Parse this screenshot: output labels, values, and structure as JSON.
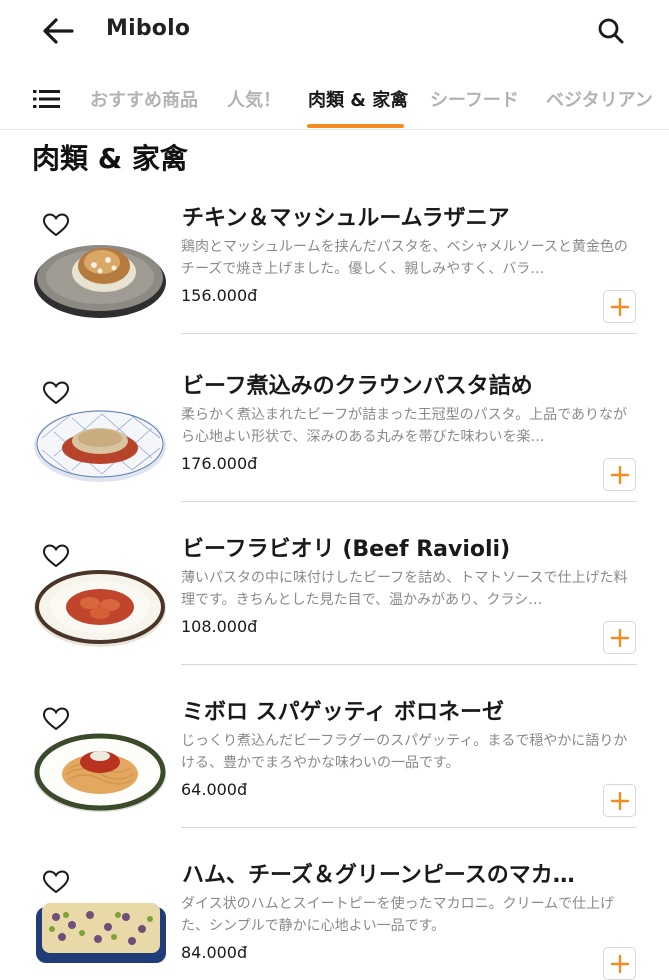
{
  "header": {
    "back_icon": "arrow-left-icon",
    "title": "Mibolo",
    "search_icon": "search-icon"
  },
  "tabs": {
    "menu_icon": "list-menu-icon",
    "items": [
      {
        "label": "おすすめ商品",
        "active": false
      },
      {
        "label": "人気！",
        "active": false
      },
      {
        "label": "肉類 & 家禽",
        "active": true
      },
      {
        "label": "シーフード",
        "active": false
      },
      {
        "label": "ベジタリアン",
        "active": false
      }
    ],
    "accent_color": "#f68b1f"
  },
  "section": {
    "title": "肉類 & 家禽"
  },
  "products": [
    {
      "name": "チキン＆マッシュルームラザニア",
      "description": "鶏肉とマッシュルームを挟んだパスタを、ベシャメルソースと黄金色のチーズで焼き上げました。優しく、親しみやすく、バラ…",
      "price": "156.000đ"
    },
    {
      "name": "ビーフ煮込みのクラウンパスタ詰め",
      "description": "柔らかく煮込まれたビーフが詰まった王冠型のパスタ。上品でありながら心地よい形状で、深みのある丸みを帯びた味わいを楽…",
      "price": "176.000đ"
    },
    {
      "name": "ビーフラビオリ (Beef Ravioli)",
      "description": "薄いパスタの中に味付けしたビーフを詰め、トマトソースで仕上げた料理です。きちんとした見た目で、温かみがあり、クラシ…",
      "price": "108.000đ"
    },
    {
      "name": "ミボロ スパゲッティ ボロネーゼ",
      "description": "じっくり煮込んだビーフラグーのスパゲッティ。まるで穏やかに語りかける、豊かでまろやかな味わいの一品です。",
      "price": "64.000đ"
    },
    {
      "name": "ハム、チーズ＆グリーンピースのマカ…",
      "description": "ダイス状のハムとスイートピーを使ったマカロニ。クリームで仕上げた、シンプルで静かに心地よい一品です。",
      "price": "84.000đ"
    }
  ]
}
